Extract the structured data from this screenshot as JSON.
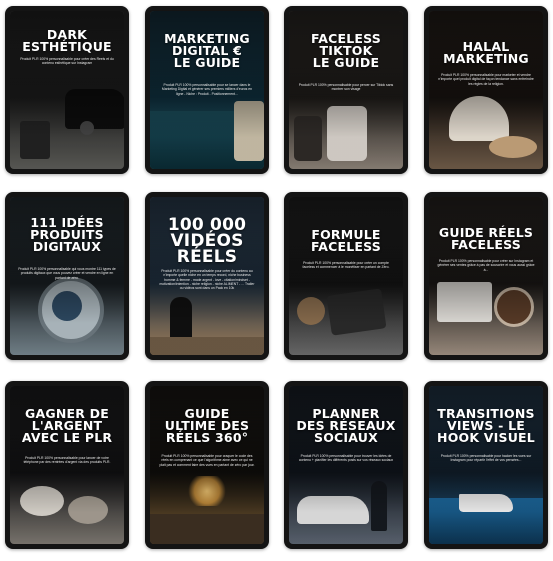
{
  "products": [
    {
      "title": "DARK\nESTHÉTIQUE",
      "description": "Produit PLR 100% personnalisable pour créer des Reels et du contenu esthétique sur Instagram",
      "palette": [
        "#2b2b2b",
        "#121212",
        "#4a4a48"
      ]
    },
    {
      "title": "MARKETING\nDIGITAL €\nLE GUIDE",
      "description": "Produit PLR 100% personnalisable pour se lancer dans le Marketing Digital et générer ses premiers milliers d'euros en ligne - Niche : Produit - Positionnement...",
      "palette": [
        "#1f4f5e",
        "#0d2a33",
        "#7a9a8a"
      ]
    },
    {
      "title": "FACELESS\nTIKTOK\nLE GUIDE",
      "description": "Produit PLR 100% personnalisable pour percer sur Tiktok sans montrer son visage",
      "palette": [
        "#3b3733",
        "#1a1816",
        "#8e8276"
      ]
    },
    {
      "title": "HALAL\nMARKETING",
      "description": "Produit PLR 100% personnalisable pour marketer et vendre n'importe quel produit digital de façon tendance sans enfreindre les règles de la religion.",
      "palette": [
        "#3a302a",
        "#161210",
        "#a88f76"
      ]
    },
    {
      "title": "111 IDÉES\nPRODUITS\nDIGITAUX",
      "description": "Produit PLR 100% personnalisable qui vous montre 111 types de produits digitaux que vous pouvez créer et vendre en ligne en partant de zéro.",
      "palette": [
        "#38454d",
        "#16191c",
        "#9aa7ad"
      ]
    },
    {
      "title": "100 000\nVIDÉOS\nRÉELS",
      "description": "Produit PLR 100% personnalisable pour créer du contenu au n'importe quelle niche en un temps record, niche business homme & femme - mode argent - love - citation/mindset - motivation/intention - niche religion - niche ALIMENT - ... Trailer ou vidéos sont dans un Pack en 10k",
      "palette": [
        "#3c5875",
        "#1a2532",
        "#b48f6a"
      ]
    },
    {
      "title": "FORMULE\nFACELESS",
      "description": "Produit PLR 100% personnalisable pour créer un compte faceless et commencer à le monétiser en partant de Zéro.",
      "palette": [
        "#333333",
        "#111111",
        "#777777"
      ]
    },
    {
      "title": "GUIDE RÉELS\nFACELESS",
      "description": "Produit PLR 100% personnalisable pour créer sur Instagram et générer ses ventes grâce à pas de souscrire et vous aussi grâce à...",
      "palette": [
        "#3a3532",
        "#141210",
        "#b9a99a"
      ]
    },
    {
      "title": "GAGNER DE\nL'ARGENT\nAVEC LE PLR",
      "description": "Produit PLR 100% personnalisable pour lancer de votre téléphone par des rentrées d'argent via des produits PLR.",
      "palette": [
        "#2d2d30",
        "#0f0f10",
        "#8c8780"
      ]
    },
    {
      "title": "GUIDE\nULTIME DES\nRÉELS 360°",
      "description": "Produit PLR 100% personnalisable pour craquer le code des réels en comprenant ce que l'algorithme aime avec ce qui ne plait pas et comment faire des vues en partant de zéro par jour.",
      "palette": [
        "#2a2622",
        "#0f0d0b",
        "#c79a55"
      ]
    },
    {
      "title": "PLANNER\nDES RÉSEAUX\nSOCIAUX",
      "description": "Produit PLR 100% personnalisable pour trouver les idées de contenu + planifier les différents posts sur vos réseaux sociaux",
      "palette": [
        "#27303c",
        "#10151c",
        "#d5d5d5"
      ]
    },
    {
      "title": "TRANSITIONS\nVIEWS - LE\nHOOK VISUEL",
      "description": "Produit PLR 100% personnalisable pour hacker les vues sur Instagram pour répartir l'effet de vos pensées...",
      "palette": [
        "#2d4f6d",
        "#0f1f2e",
        "#2a7bb0"
      ]
    }
  ]
}
